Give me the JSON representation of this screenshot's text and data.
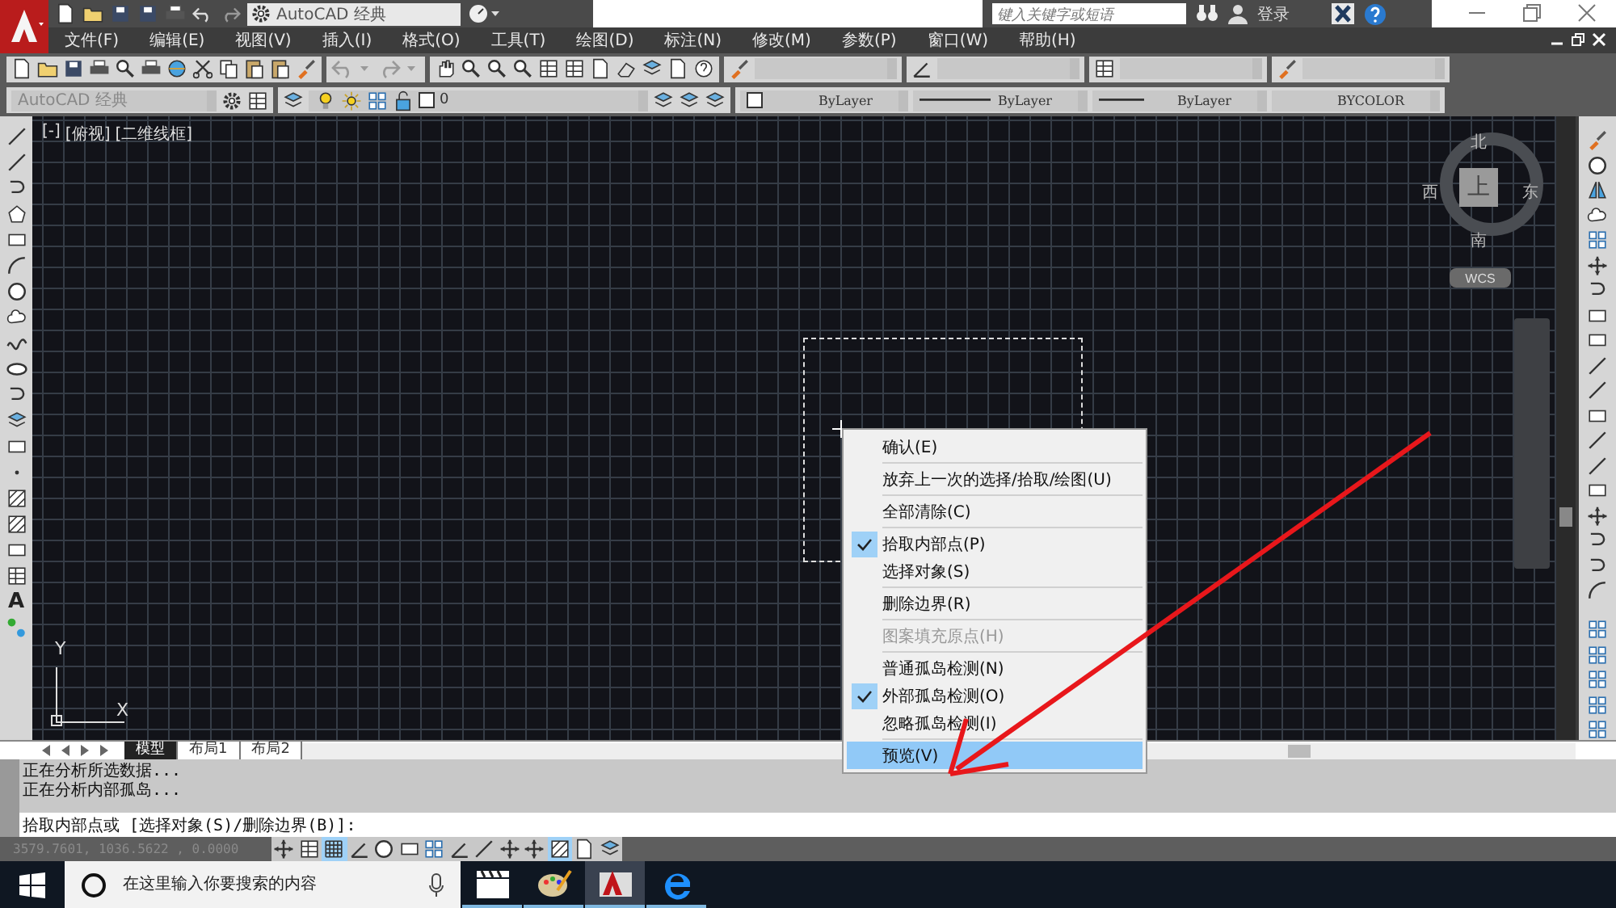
{
  "title_bar": {
    "workspace": "AutoCAD 经典",
    "search": {
      "placeholder": "键入关键字或短语"
    },
    "sign_in": "登录"
  },
  "menu_bar": [
    "文件(F)",
    "编辑(E)",
    "视图(V)",
    "插入(I)",
    "格式(O)",
    "工具(T)",
    "绘图(D)",
    "标注(N)",
    "修改(M)",
    "参数(P)",
    "窗口(W)",
    "帮助(H)"
  ],
  "workspace_dropdown": "AutoCAD 经典",
  "layer_dropdown": "0",
  "properties": [
    {
      "kind": "color",
      "value": "ByLayer"
    },
    {
      "kind": "linetype",
      "value": "ByLayer"
    },
    {
      "kind": "lineweight",
      "value": "ByLayer"
    },
    {
      "kind": "plotstyle",
      "value": "BYCOLOR"
    }
  ],
  "mtext_tool": "A",
  "viewport_controls": [
    "[-]",
    "[俯视]",
    "[二维线框]"
  ],
  "view_cube": {
    "north": "北",
    "south": "南",
    "east": "东",
    "west": "西",
    "face": "上",
    "coordinate_system": "WCS"
  },
  "ucs_icon": {
    "x": "X",
    "y": "Y"
  },
  "context_menu": {
    "groups": [
      [
        {
          "label": "确认(E)",
          "checked": false,
          "disabled": false,
          "selected": false
        }
      ],
      [
        {
          "label": "放弃上一次的选择/拾取/绘图(U)",
          "checked": false,
          "disabled": false,
          "selected": false
        }
      ],
      [
        {
          "label": "全部清除(C)",
          "checked": false,
          "disabled": false,
          "selected": false
        }
      ],
      [
        {
          "label": "拾取内部点(P)",
          "checked": true,
          "disabled": false,
          "selected": false
        },
        {
          "label": "选择对象(S)",
          "checked": false,
          "disabled": false,
          "selected": false
        }
      ],
      [
        {
          "label": "删除边界(R)",
          "checked": false,
          "disabled": false,
          "selected": false
        }
      ],
      [
        {
          "label": "图案填充原点(H)",
          "checked": false,
          "disabled": true,
          "selected": false
        }
      ],
      [
        {
          "label": "普通孤岛检测(N)",
          "checked": false,
          "disabled": false,
          "selected": false
        },
        {
          "label": "外部孤岛检测(O)",
          "checked": true,
          "disabled": false,
          "selected": false
        },
        {
          "label": "忽略孤岛检测(I)",
          "checked": false,
          "disabled": false,
          "selected": false
        }
      ],
      [
        {
          "label": "预览(V)",
          "checked": false,
          "disabled": false,
          "selected": true
        }
      ]
    ]
  },
  "layout_tabs": [
    {
      "label": "模型",
      "selected": true
    },
    {
      "label": "布局1",
      "selected": false
    },
    {
      "label": "布局2",
      "selected": false
    }
  ],
  "command_history": [
    "正在分析所选数据...",
    "正在分析内部孤岛..."
  ],
  "command_prompt": "拾取内部点或 [选择对象(S)/删除边界(B)]:",
  "status_bar": {
    "coordinates": "3579.7601, 1036.5622 , 0.0000",
    "toggles": [
      {
        "on": false
      },
      {
        "on": false
      },
      {
        "on": true
      },
      {
        "on": false
      },
      {
        "on": false
      },
      {
        "on": false
      },
      {
        "on": false
      },
      {
        "on": false
      },
      {
        "on": false
      },
      {
        "on": false
      },
      {
        "on": false
      },
      {
        "on": true
      },
      {
        "on": false
      },
      {
        "on": false
      }
    ]
  },
  "taskbar": {
    "search": {
      "placeholder": "在这里输入你要搜索的内容"
    },
    "apps": [
      {
        "selected": false
      },
      {
        "selected": false
      },
      {
        "selected": true
      },
      {
        "selected": false
      }
    ]
  }
}
